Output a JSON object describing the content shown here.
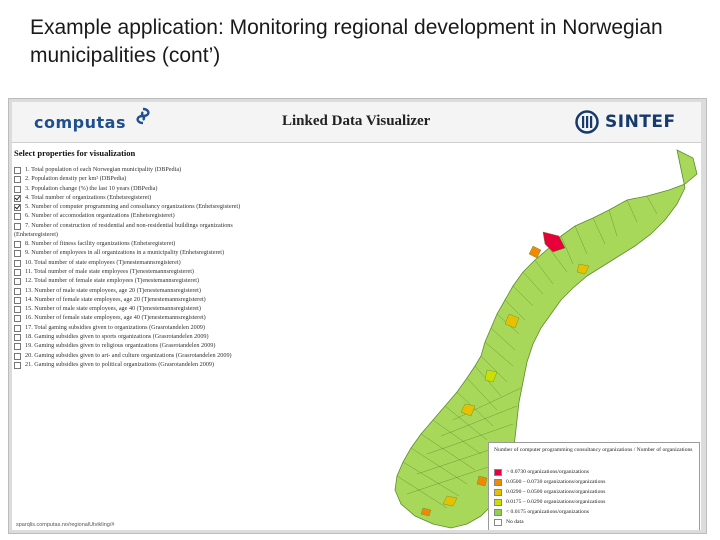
{
  "slide": {
    "title": "Example application: Monitoring regional development in Norwegian municipalities (cont’)"
  },
  "app": {
    "title": "Linked Data Visualizer",
    "logo_left": "computas",
    "logo_right": "SINTEF",
    "footer_url": "sparqlis.computas.no/regionalUtvikling/#"
  },
  "properties": {
    "heading": "Select properties for visualization",
    "items": [
      {
        "label": "1. Total population of each Norwegian municipality (DBPedia)",
        "checked": false
      },
      {
        "label": "2. Population density per km² (DBPedia)",
        "checked": false
      },
      {
        "label": "3. Population change (%) the last 10 years (DBPedia)",
        "checked": false
      },
      {
        "label": "4. Total number of organizations (Enhetsregisteret)",
        "checked": true
      },
      {
        "label": "5. Number of computer programming and consultancy organizations (Enhetsregisteret)",
        "checked": true
      },
      {
        "label": "6. Number of accomodation organizations (Enhetsregisteret)",
        "checked": false
      },
      {
        "label": "7. Number of construction of residential and non-residential buildings organizations",
        "checked": false,
        "wrap": "(Enhetsregisteret)"
      },
      {
        "label": "8. Number of fitness facility organizations (Enhetsregisteret)",
        "checked": false
      },
      {
        "label": "9. Number of employees in all organizations in a municipality (Enhetsregisteret)",
        "checked": false
      },
      {
        "label": "10. Total number of state employees (Tjenestemannsregisteret)",
        "checked": false
      },
      {
        "label": "11. Total number of male state employees (Tjenestemannsregisteret)",
        "checked": false
      },
      {
        "label": "12. Total number of female state employees (Tjenestemannsregisteret)",
        "checked": false
      },
      {
        "label": "13. Number of male state employees, age 20 (Tjenestemannsregisteret)",
        "checked": false
      },
      {
        "label": "14. Number of female state employees, age 20 (Tjenestemannsregisteret)",
        "checked": false
      },
      {
        "label": "15. Number of male state employees, age 40 (Tjenestemannsregisteret)",
        "checked": false
      },
      {
        "label": "16. Number of female state employees, age 40 (Tjenestemannsregisteret)",
        "checked": false
      },
      {
        "label": "17. Total gaming subsidies given to organizations (Grasrotandelen 2009)",
        "checked": false
      },
      {
        "label": "18. Gaming subsidies given to sports organizations (Grasrotandelen 2009)",
        "checked": false
      },
      {
        "label": "19. Gaming subsidies given to religious organizations (Grasrotandelen 2009)",
        "checked": false
      },
      {
        "label": "20. Gaming subsidies given to art- and culture organizations (Grasrotandelen 2009)",
        "checked": false
      },
      {
        "label": "21. Gaming subsidies given to political organizations (Grasrotandelen 2009)",
        "checked": false
      }
    ]
  },
  "legend": {
    "title": "Number of computer programming consultancy organizations / Number of organizations",
    "items": [
      {
        "label": "> 0.0730 organizations/organizations",
        "color": "#e8003a"
      },
      {
        "label": "0.0500 – 0.0730 organizations/organizations",
        "color": "#f08a00"
      },
      {
        "label": "0.0290 – 0.0500 organizations/organizations",
        "color": "#e7c000"
      },
      {
        "label": "0.0175 – 0.0290 organizations/organizations",
        "color": "#c9e000"
      },
      {
        "label": "< 0.0175 organizations/organizations",
        "color": "#8fd14f"
      },
      {
        "label": "No data",
        "color": "#ffffff"
      }
    ]
  },
  "colors": {
    "map_base": "#a8d85a",
    "map_border": "#5d8a2f",
    "highlight": "#e8003a"
  }
}
